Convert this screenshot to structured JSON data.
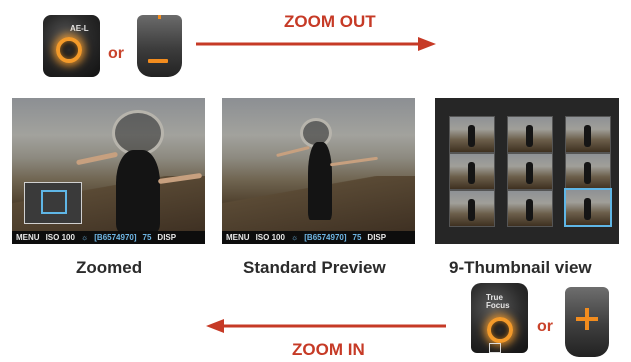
{
  "top": {
    "ae_l_button_label": "AE-L",
    "or_label": "or",
    "zoom_out_label": "ZOOM OUT"
  },
  "bottom": {
    "true_focus_label": "True Focus",
    "or_label": "or",
    "zoom_in_label": "ZOOM IN"
  },
  "screens": {
    "zoomed": {
      "caption": "Zoomed",
      "status": [
        "MENU",
        "ISO 100",
        "☼",
        "[B6574970]",
        "75",
        "DISP"
      ]
    },
    "standard": {
      "caption": "Standard Preview",
      "status": [
        "MENU",
        "ISO 100",
        "☼",
        "[B6574970]",
        "75",
        "DISP"
      ]
    },
    "thumbnails": {
      "caption": "9-Thumbnail view",
      "count": 9,
      "selected_index": 8
    }
  },
  "colors": {
    "accent_orange": "#f28c1e",
    "arrow_red": "#c63a26",
    "selection_blue": "#5fb6e6"
  },
  "icons": [
    "ael-button-icon",
    "minus-button-icon",
    "true-focus-button-icon",
    "plus-button-icon",
    "arrow-right-icon",
    "arrow-left-icon"
  ]
}
